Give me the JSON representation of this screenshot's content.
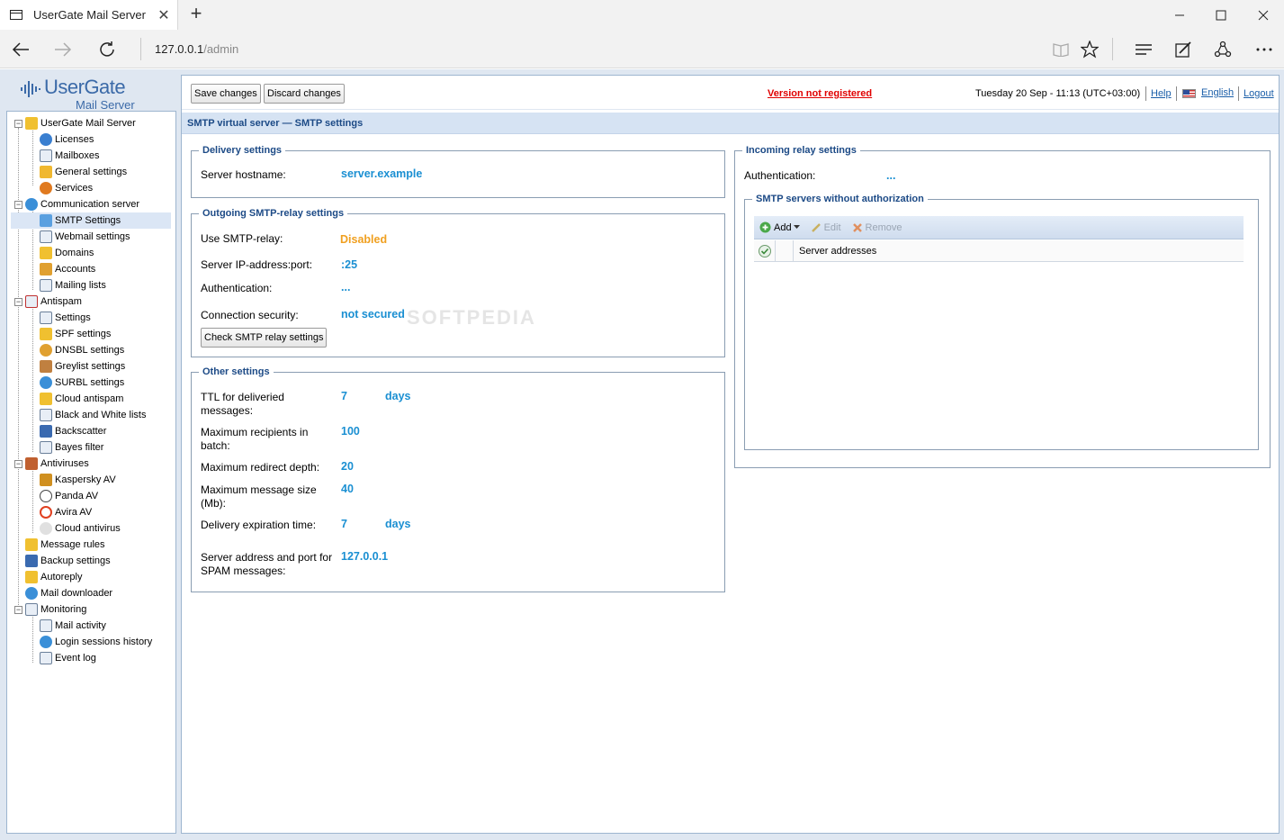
{
  "browser": {
    "tab_title": "UserGate Mail Server",
    "tab_close": "✕",
    "new_tab": "+",
    "url_host": "127.0.0.1",
    "url_path": "/admin"
  },
  "logo": {
    "main": "UserGate",
    "sub": "Mail Server"
  },
  "toolbar": {
    "save_label": "Save changes",
    "discard_label": "Discard changes",
    "not_registered": "Version not registered",
    "datetime": "Tuesday 20 Sep - 11:13 (UTC+03:00)",
    "help": "Help",
    "language": "English",
    "logout": "Logout"
  },
  "tree": {
    "root": "UserGate Mail Server",
    "licenses": "Licenses",
    "mailboxes": "Mailboxes",
    "general_settings": "General settings",
    "services": "Services",
    "comm_server": "Communication server",
    "smtp_settings": "SMTP Settings",
    "webmail_settings": "Webmail settings",
    "domains": "Domains",
    "accounts": "Accounts",
    "mailing_lists": "Mailing lists",
    "antispam": "Antispam",
    "as_settings": "Settings",
    "spf": "SPF settings",
    "dnsbl": "DNSBL settings",
    "greylist": "Greylist settings",
    "surbl": "SURBL settings",
    "cloud_antispam": "Cloud antispam",
    "bw_lists": "Black and White lists",
    "backscatter": "Backscatter",
    "bayes": "Bayes filter",
    "antiviruses": "Antiviruses",
    "kaspersky": "Kaspersky AV",
    "panda": "Panda AV",
    "avira": "Avira AV",
    "cloud_av": "Cloud antivirus",
    "message_rules": "Message rules",
    "backup": "Backup settings",
    "autoreply": "Autoreply",
    "downloader": "Mail downloader",
    "monitoring": "Monitoring",
    "mail_activity": "Mail activity",
    "login_history": "Login sessions history",
    "event_log": "Event log"
  },
  "page": {
    "title": "SMTP virtual server — SMTP settings"
  },
  "delivery": {
    "legend": "Delivery settings",
    "hostname_label": "Server hostname:",
    "hostname_value": "server.example"
  },
  "relay": {
    "legend": "Outgoing SMTP-relay settings",
    "use_label": "Use SMTP-relay:",
    "use_value": "Disabled",
    "ip_label": "Server IP-address:port:",
    "ip_value": ":25",
    "auth_label": "Authentication:",
    "auth_value": "...",
    "sec_label": "Connection security:",
    "sec_value": "not secured",
    "check_button": "Check SMTP relay settings"
  },
  "other": {
    "legend": "Other settings",
    "ttl_label": "TTL for deliveried messages:",
    "ttl_value": "7",
    "ttl_unit": "days",
    "maxrcpt_label": "Maximum recipients in batch:",
    "maxrcpt_value": "100",
    "redirect_label": "Maximum redirect depth:",
    "redirect_value": "20",
    "msgsize_label": "Maximum message size (Mb):",
    "msgsize_value": "40",
    "expire_label": "Delivery expiration time:",
    "expire_value": "7",
    "expire_unit": "days",
    "spam_label": "Server address and port for SPAM messages:",
    "spam_value": "127.0.0.1"
  },
  "incoming": {
    "legend": "Incoming relay settings",
    "auth_label": "Authentication:",
    "auth_value": "...",
    "noauth_legend": "SMTP servers without authorization",
    "add": "Add",
    "edit": "Edit",
    "remove": "Remove",
    "col_addresses": "Server addresses"
  },
  "watermark": "SOFTPEDIA",
  "colors": {
    "accent": "#1a8fd2",
    "warning": "#e00000",
    "disabled": "#f0a020",
    "header": "#1c4a86"
  }
}
